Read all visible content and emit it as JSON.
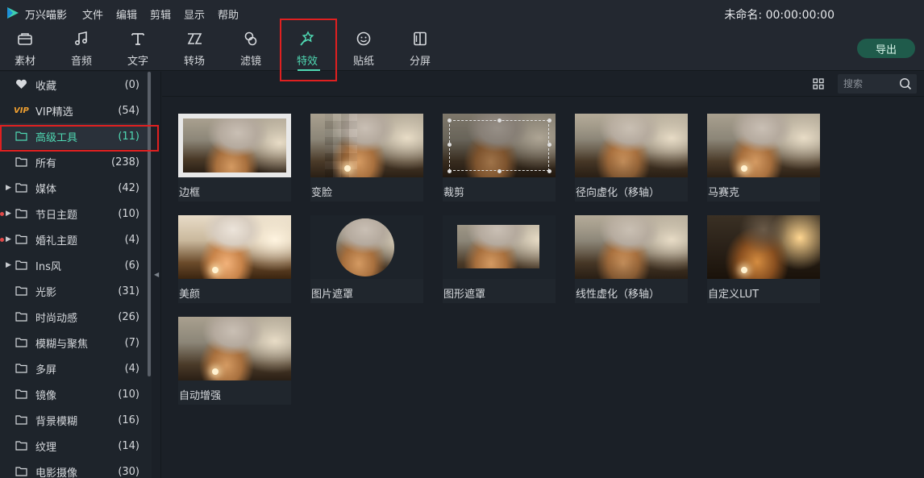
{
  "app": {
    "title": "万兴喵影",
    "project_title": "未命名: 00:00:00:00"
  },
  "menu": [
    "文件",
    "编辑",
    "剪辑",
    "显示",
    "帮助"
  ],
  "toolbar": {
    "tabs": [
      {
        "label": "素材",
        "icon": "media-icon"
      },
      {
        "label": "音频",
        "icon": "music-note-icon"
      },
      {
        "label": "文字",
        "icon": "text-icon"
      },
      {
        "label": "转场",
        "icon": "transition-icon"
      },
      {
        "label": "滤镜",
        "icon": "filter-icon"
      },
      {
        "label": "特效",
        "icon": "effects-wand-icon",
        "active": true
      },
      {
        "label": "贴纸",
        "icon": "sticker-icon"
      },
      {
        "label": "分屏",
        "icon": "split-screen-icon"
      }
    ],
    "export_label": "导出"
  },
  "sidebar": {
    "items": [
      {
        "label": "收藏",
        "count": "(0)",
        "icon": "heart-icon"
      },
      {
        "label": "VIP精选",
        "count": "(54)",
        "icon": "vip-badge",
        "badge": "VIP"
      },
      {
        "label": "高级工具",
        "count": "(11)",
        "icon": "folder-icon",
        "active": true
      },
      {
        "label": "所有",
        "count": "(238)",
        "icon": "folder-icon"
      },
      {
        "label": "媒体",
        "count": "(42)",
        "icon": "folder-icon",
        "expandable": true
      },
      {
        "label": "节日主题",
        "count": "(10)",
        "icon": "folder-icon",
        "expandable": true,
        "new_dot": true
      },
      {
        "label": "婚礼主题",
        "count": "(4)",
        "icon": "folder-icon",
        "expandable": true,
        "new_dot": true
      },
      {
        "label": "Ins风",
        "count": "(6)",
        "icon": "folder-icon",
        "expandable": true
      },
      {
        "label": "光影",
        "count": "(31)",
        "icon": "folder-icon"
      },
      {
        "label": "时尚动感",
        "count": "(26)",
        "icon": "folder-icon"
      },
      {
        "label": "模糊与聚焦",
        "count": "(7)",
        "icon": "folder-icon"
      },
      {
        "label": "多屏",
        "count": "(4)",
        "icon": "folder-icon"
      },
      {
        "label": "镜像",
        "count": "(10)",
        "icon": "folder-icon"
      },
      {
        "label": "背景模糊",
        "count": "(16)",
        "icon": "folder-icon"
      },
      {
        "label": "纹理",
        "count": "(14)",
        "icon": "folder-icon"
      },
      {
        "label": "电影摄像",
        "count": "(30)",
        "icon": "folder-icon"
      }
    ]
  },
  "search": {
    "placeholder": "搜索"
  },
  "effects": [
    {
      "label": "边框",
      "style": "frame"
    },
    {
      "label": "变脸",
      "style": "pixelate"
    },
    {
      "label": "裁剪",
      "style": "crop"
    },
    {
      "label": "径向虚化（移轴）",
      "style": "radial-blur"
    },
    {
      "label": "马赛克",
      "style": "mosaic"
    },
    {
      "label": "美颜",
      "style": "beauty"
    },
    {
      "label": "图片遮罩",
      "style": "image-mask"
    },
    {
      "label": "图形遮罩",
      "style": "shape-mask"
    },
    {
      "label": "线性虚化（移轴）",
      "style": "linear-blur"
    },
    {
      "label": "自定义LUT",
      "style": "lut"
    },
    {
      "label": "自动增强",
      "style": "auto-enhance"
    }
  ],
  "colors": {
    "accent": "#4fd9b3",
    "highlight": "#e02020",
    "export_bg": "#1f5b4b"
  }
}
